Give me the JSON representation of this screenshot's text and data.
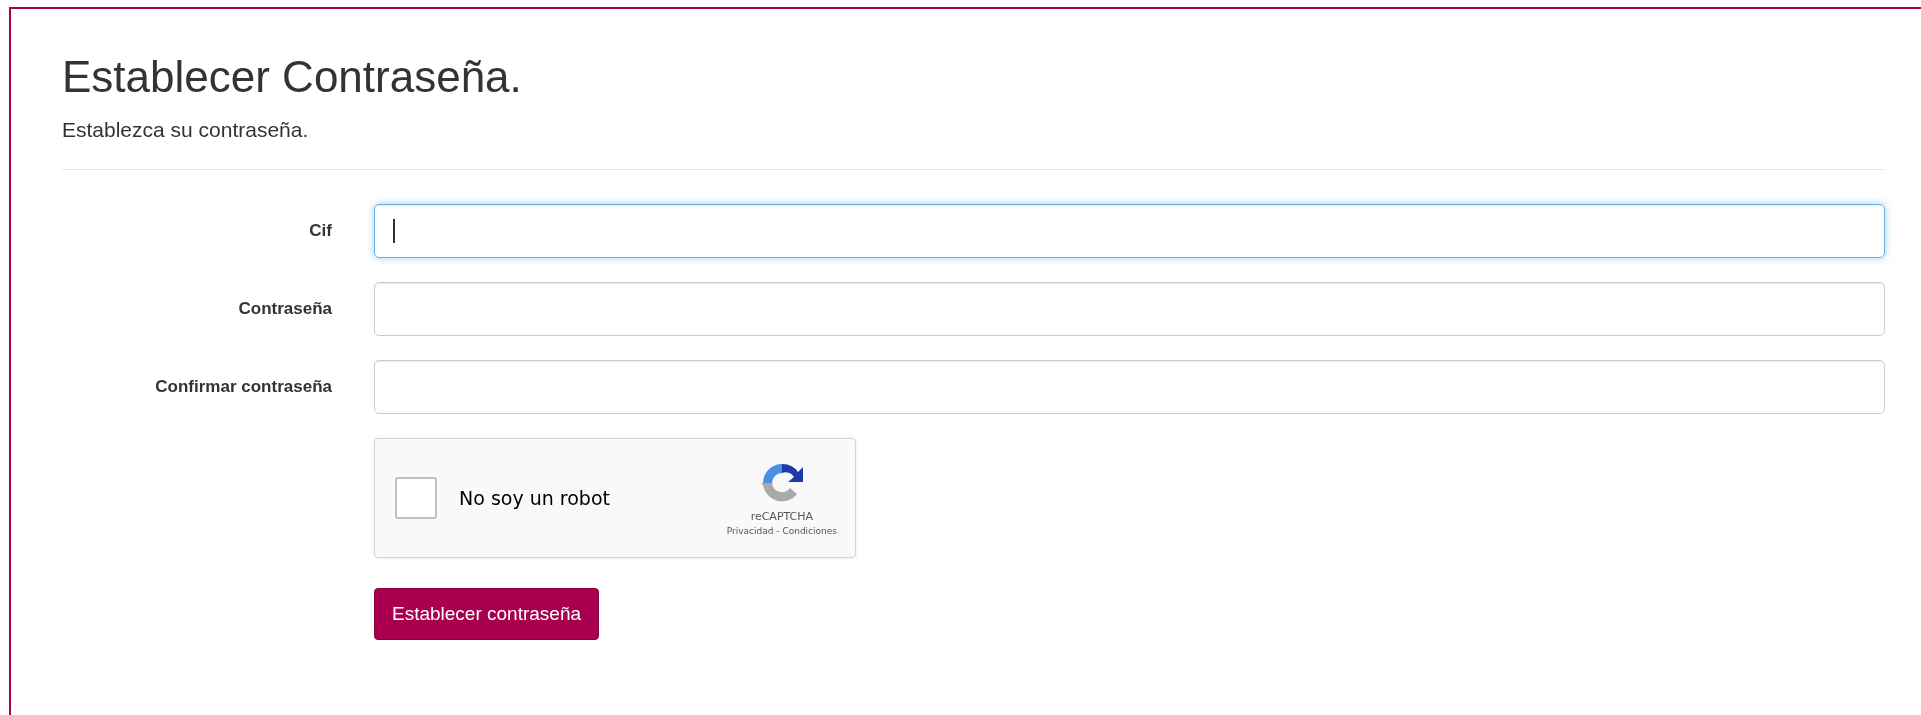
{
  "title": "Establecer Contraseña.",
  "subtitle": "Establezca su contraseña.",
  "fields": [
    {
      "label": "Cif",
      "focused": true
    },
    {
      "label": "Contraseña",
      "focused": false
    },
    {
      "label": "Confirmar contraseña",
      "focused": false
    }
  ],
  "captcha": {
    "label": "No soy un robot",
    "checked": false,
    "brand": "reCAPTCHA",
    "links": [
      "Privacidad",
      "Condiciones"
    ],
    "separator": "-"
  },
  "submit": "Establecer contraseña"
}
